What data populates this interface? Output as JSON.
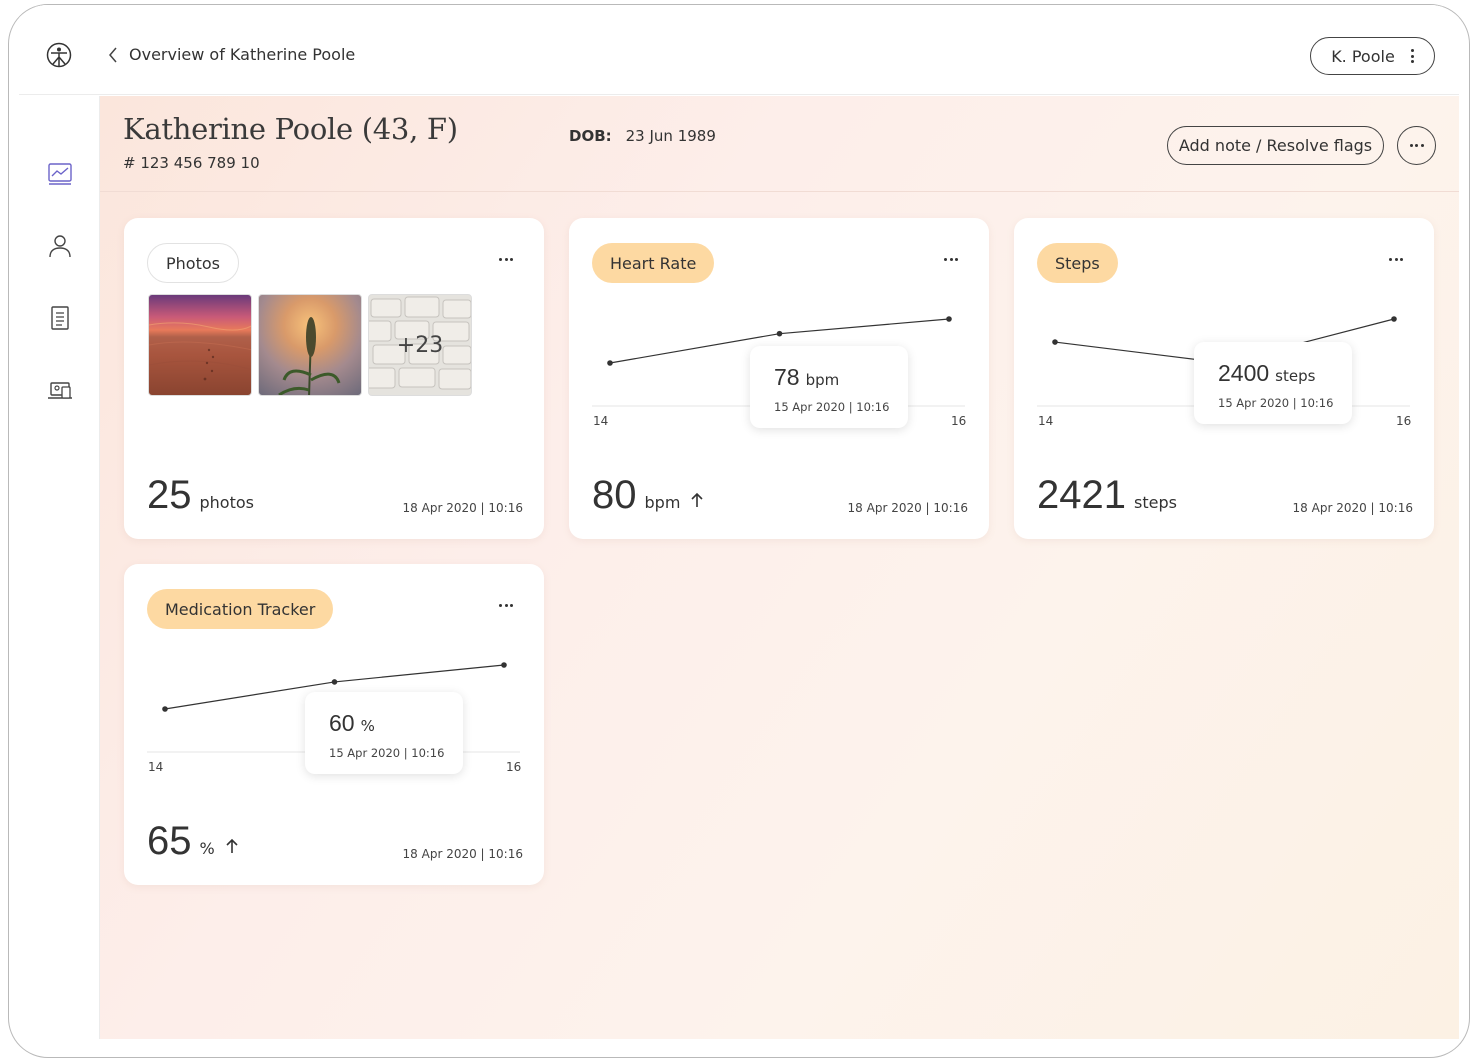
{
  "topbar": {
    "back_label": "Overview of Katherine Poole",
    "user_label": "K. Poole"
  },
  "sidebar": {
    "items": [
      {
        "icon": "chart-icon",
        "active": true
      },
      {
        "icon": "person-icon",
        "active": false
      },
      {
        "icon": "document-icon",
        "active": false
      },
      {
        "icon": "devices-icon",
        "active": false
      }
    ]
  },
  "patient": {
    "name": "Katherine Poole (43, F)",
    "id": "# 123 456 789 10",
    "dob_label": "DOB:",
    "dob_value": "23 Jun 1989",
    "note_button": "Add note / Resolve flags"
  },
  "cards": {
    "photos": {
      "chip": "Photos",
      "more_label": "+23",
      "value": "25",
      "unit": "photos",
      "timestamp": "18 Apr 2020 | 10:16"
    },
    "heart_rate": {
      "chip": "Heart Rate",
      "value": "80",
      "unit": "bpm",
      "trend": "up",
      "timestamp": "18 Apr 2020 | 10:16",
      "tooltip_value": "78",
      "tooltip_unit": "bpm",
      "tooltip_date": "15 Apr 2020 | 10:16",
      "tick_left": "14",
      "tick_right": "16"
    },
    "steps": {
      "chip": "Steps",
      "value": "2421",
      "unit": "steps",
      "timestamp": "18 Apr 2020 | 10:16",
      "tooltip_value": "2400",
      "tooltip_unit": "steps",
      "tooltip_date": "15 Apr 2020 | 10:16",
      "tick_left": "14",
      "tick_right": "16"
    },
    "medication": {
      "chip": "Medication Tracker",
      "value": "65",
      "unit": "%",
      "trend": "up",
      "timestamp": "18 Apr 2020 | 10:16",
      "tooltip_value": "60",
      "tooltip_unit": "%",
      "tooltip_date": "15 Apr 2020 | 10:16",
      "tick_left": "14",
      "tick_right": "16"
    }
  },
  "chart_data": [
    {
      "type": "line",
      "x": [
        14,
        15,
        16
      ],
      "series": [
        {
          "values": [
            74,
            78,
            80
          ]
        }
      ]
    },
    {
      "type": "line",
      "x": [
        14,
        15,
        16
      ],
      "series": [
        {
          "values": [
            2410,
            2400,
            2421
          ]
        }
      ]
    },
    {
      "type": "line",
      "x": [
        14,
        15,
        16
      ],
      "series": [
        {
          "values": [
            52,
            60,
            65
          ]
        }
      ]
    }
  ],
  "colors": {
    "chip_fill": "#fdd9a2",
    "accent": "#6b63c9"
  }
}
